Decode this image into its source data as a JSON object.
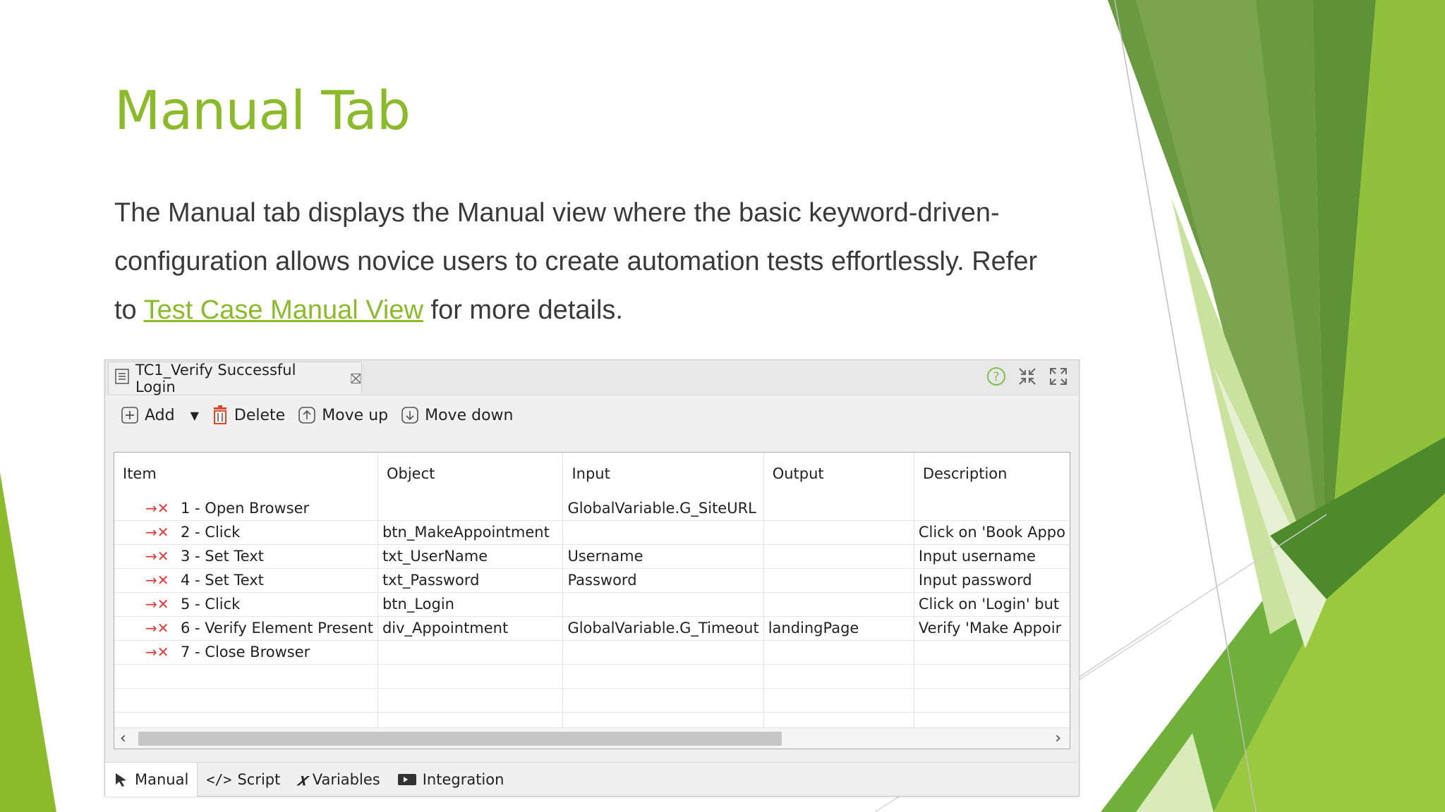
{
  "slide": {
    "title": "Manual Tab",
    "body_before_link": "The Manual tab displays the Manual view where the basic keyword-driven-configuration allows novice users to create automation tests effortlessly. Refer to ",
    "link_text": "Test Case Manual View",
    "body_after_link": " for more details."
  },
  "editor": {
    "tab_title": "TC1_Verify Successful Login",
    "tab_close_icon": "close-icon",
    "actions": [
      "help-icon",
      "collapse-icon",
      "expand-icon"
    ]
  },
  "toolbar": {
    "add_label": "Add",
    "delete_label": "Delete",
    "move_up_label": "Move up",
    "move_down_label": "Move down"
  },
  "table": {
    "columns": [
      "Item",
      "Object",
      "Input",
      "Output",
      "Description"
    ],
    "rows": [
      {
        "item": "1 - Open Browser",
        "object": "",
        "input": "GlobalVariable.G_SiteURL",
        "output": "",
        "description": ""
      },
      {
        "item": "2 - Click",
        "object": "btn_MakeAppointment",
        "input": "",
        "output": "",
        "description": "Click on 'Book Appo"
      },
      {
        "item": "3 - Set Text",
        "object": "txt_UserName",
        "input": "Username",
        "output": "",
        "description": "Input username"
      },
      {
        "item": "4 - Set Text",
        "object": "txt_Password",
        "input": "Password",
        "output": "",
        "description": "Input password"
      },
      {
        "item": "5 - Click",
        "object": "btn_Login",
        "input": "",
        "output": "",
        "description": "Click on 'Login' but"
      },
      {
        "item": "6 - Verify Element Present",
        "object": "div_Appointment",
        "input": "GlobalVariable.G_Timeout",
        "output": "landingPage",
        "description": "Verify 'Make Appoir"
      },
      {
        "item": "7 - Close Browser",
        "object": "",
        "input": "",
        "output": "",
        "description": ""
      }
    ]
  },
  "bottom_tabs": [
    "Manual",
    "Script",
    "Variables",
    "Integration"
  ],
  "colors": {
    "accent": "#8bbb2a",
    "step_icon": "#e53935"
  }
}
